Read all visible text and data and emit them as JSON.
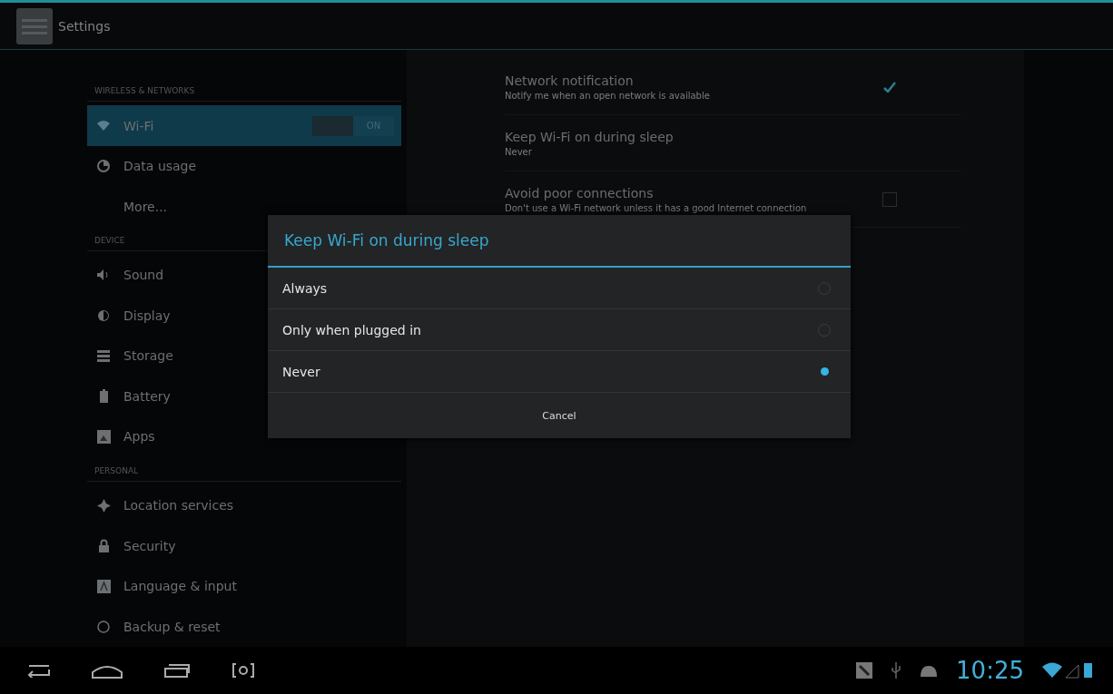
{
  "action_bar": {
    "title": "Settings"
  },
  "sidebar": {
    "items": [
      {
        "kind": "header",
        "label": "WIRELESS & NETWORKS"
      },
      {
        "kind": "item",
        "label": "Wi-Fi",
        "selected": true,
        "toggle": {
          "label": "ON",
          "on": true
        }
      },
      {
        "kind": "item",
        "label": "Data usage",
        "selected": false
      },
      {
        "kind": "item",
        "label": "More...",
        "selected": false
      },
      {
        "kind": "header",
        "label": "DEVICE"
      },
      {
        "kind": "item",
        "label": "Sound",
        "selected": false
      },
      {
        "kind": "item",
        "label": "Display",
        "selected": false
      },
      {
        "kind": "item",
        "label": "Storage",
        "selected": false
      },
      {
        "kind": "item",
        "label": "Battery",
        "selected": false
      },
      {
        "kind": "item",
        "label": "Apps",
        "selected": false
      },
      {
        "kind": "header",
        "label": "PERSONAL"
      },
      {
        "kind": "item",
        "label": "Location services",
        "selected": false
      },
      {
        "kind": "item",
        "label": "Security",
        "selected": false
      },
      {
        "kind": "item",
        "label": "Language & input",
        "selected": false
      },
      {
        "kind": "item",
        "label": "Backup & reset",
        "selected": false
      }
    ]
  },
  "preferences": [
    {
      "kind": "checkbox",
      "title": "Network notification",
      "summary": "Notify me when an open network is available",
      "checked": true
    },
    {
      "kind": "plain",
      "title": "Keep Wi-Fi on during sleep",
      "summary": "Never"
    },
    {
      "kind": "checkbox",
      "title": "Avoid poor connections",
      "summary": "Don't use a Wi-Fi network unless it has a good Internet connection",
      "checked": false
    }
  ],
  "dialog": {
    "title": "Keep Wi-Fi on during sleep",
    "options": [
      {
        "label": "Always",
        "selected": false
      },
      {
        "label": "Only when plugged in",
        "selected": false
      },
      {
        "label": "Never",
        "selected": true
      }
    ],
    "button": "Cancel"
  },
  "status_bar": {
    "time": "10:25"
  }
}
